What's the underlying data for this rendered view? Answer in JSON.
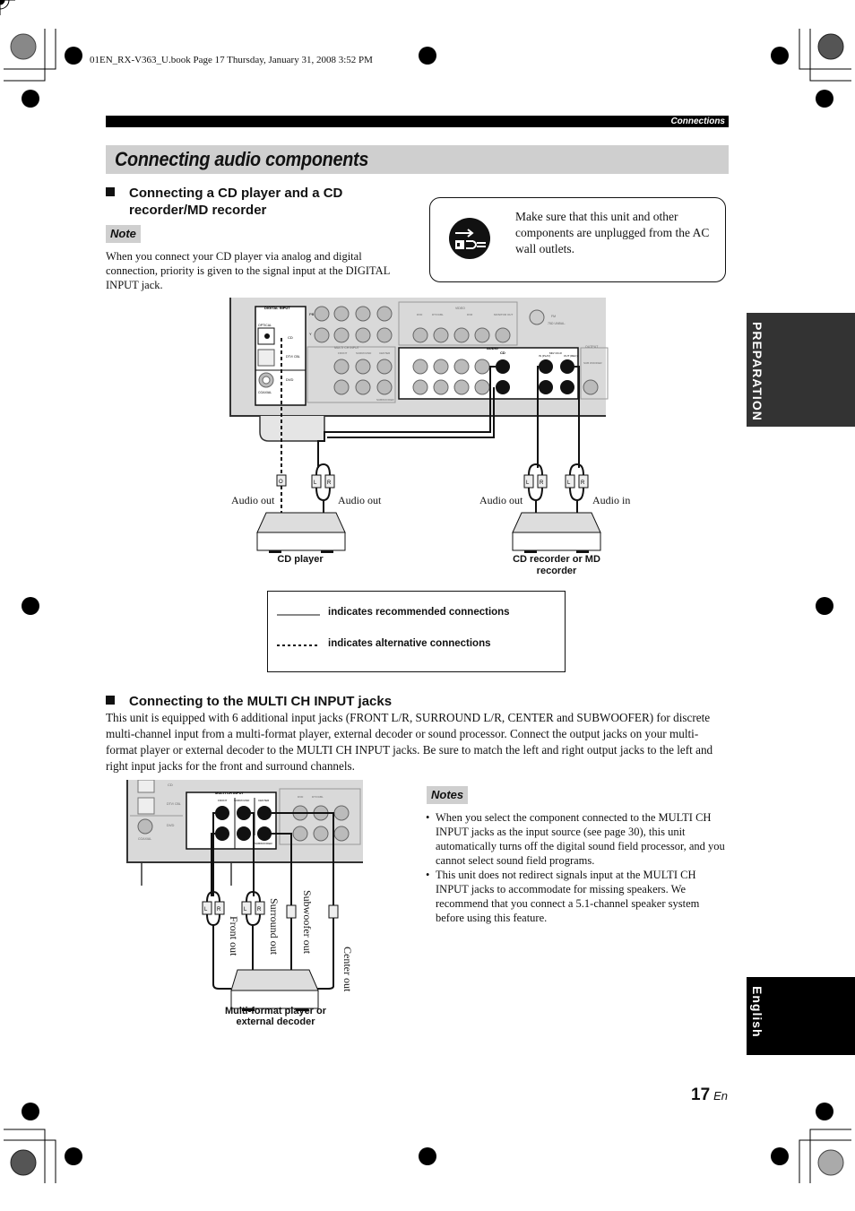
{
  "print_header": "01EN_RX-V363_U.book  Page 17  Thursday, January 31, 2008  3:52 PM",
  "running_header": "Connections",
  "page_title": "Connecting audio components",
  "section1": {
    "heading": "Connecting a CD player and a CD recorder/MD recorder",
    "note_label": "Note",
    "note_text": "When you connect your CD player via analog and digital connection, priority is given to the signal input at the DIGITAL INPUT jack."
  },
  "warning": {
    "icon": "unplug-icon",
    "text": "Make sure that this unit and other components are unplugged from the AC wall outlets."
  },
  "diagram1": {
    "panel_labels": {
      "digital_input": "DIGITAL INPUT",
      "optical": "OPTICAL",
      "cd": "CD",
      "dtv_cbl": "DTV/ CBL",
      "dvd": "DVD",
      "coaxial": "COAXIAL",
      "multi_ch_input": "MULTI CH INPUT",
      "front": "FRONT",
      "surround": "SURROUND",
      "center": "CENTER",
      "subwoofer": "SUBWOOFER",
      "video": "VIDEO",
      "audio": "AUDIO",
      "dvr": "DVR",
      "in": "IN",
      "out": "OUT",
      "dtv_cbl2": "DTV/CBL",
      "monitor_out": "MONITOR OUT",
      "md_cdr": "MD/ CD-R",
      "in_play": "IN (PLAY)",
      "out_rec": "OUT (REC)",
      "output": "OUTPUT",
      "sub_woofer": "SUB WOOFER",
      "fm": "FM",
      "fm_unbal": "75Ω UNBAL.",
      "pb": "PB",
      "y": "Y"
    },
    "plug_labels": {
      "optical": "O",
      "left": "L",
      "right": "R"
    },
    "cd_player": {
      "label": "CD player",
      "out_left": "Audio out",
      "out_right": "Audio out"
    },
    "recorder": {
      "label": "CD recorder or MD recorder",
      "out": "Audio out",
      "in": "Audio in"
    }
  },
  "legend": {
    "recommended": "indicates recommended connections",
    "alternative": "indicates alternative connections"
  },
  "section2": {
    "heading": "Connecting to the MULTI CH INPUT jacks",
    "body": "This unit is equipped with 6 additional input jacks (FRONT L/R, SURROUND L/R, CENTER and SUBWOOFER) for discrete multi-channel input from a multi-format player, external decoder or sound processor. Connect the output jacks on your multi-format player or external decoder to the MULTI CH INPUT jacks. Be sure to match the left and right output jacks to the left and right input jacks for the front and surround channels."
  },
  "diagram2": {
    "outputs": [
      "Front out",
      "Surround out",
      "Subwoofer out",
      "Center out"
    ],
    "device_label": "Multi-format player or external decoder"
  },
  "notes": {
    "label": "Notes",
    "items": [
      "When you select the component connected to the MULTI CH INPUT jacks as the input source (see page 30), this unit automatically turns off the digital sound field processor, and you cannot select sound field programs.",
      "This unit does not redirect signals input at the MULTI CH INPUT jacks to accommodate for missing speakers. We recommend that you connect a 5.1-channel speaker system before using this feature."
    ]
  },
  "side_tabs": {
    "preparation": "PREPARATION",
    "english": "English"
  },
  "page_number": {
    "number": "17",
    "suffix": "En"
  }
}
